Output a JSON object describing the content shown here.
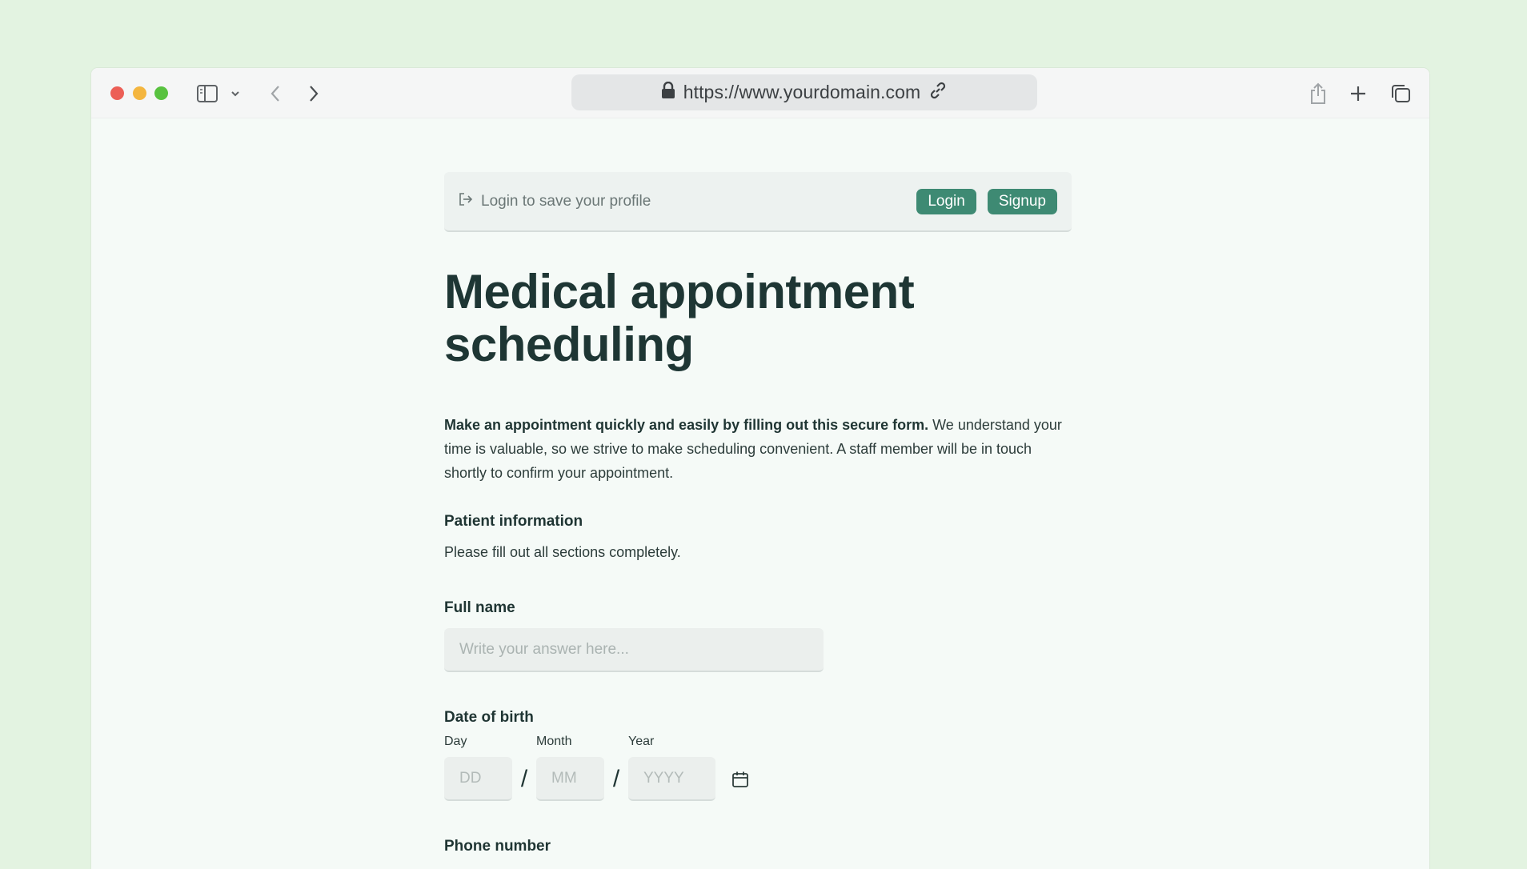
{
  "browser": {
    "url": "https://www.yourdomain.com",
    "icons": [
      "lock-icon",
      "link-icon",
      "sidebar-icon",
      "chevron-down-icon",
      "back-icon",
      "forward-icon",
      "share-icon",
      "new-tab-icon",
      "tabs-overview-icon"
    ]
  },
  "login_bar": {
    "text": "Login to save your profile",
    "login_label": "Login",
    "signup_label": "Signup"
  },
  "page": {
    "title": "Medical appointment scheduling",
    "intro_bold": "Make an appointment quickly and easily by filling out this secure form.",
    "intro_rest": " We understand your time is valuable, so we strive to make scheduling convenient. A staff member will be in touch shortly to confirm your appointment."
  },
  "section": {
    "title": "Patient information",
    "subtitle": "Please fill out all sections completely."
  },
  "fields": {
    "full_name": {
      "label": "Full name",
      "placeholder": "Write your answer here..."
    },
    "dob": {
      "label": "Date of birth",
      "day_caption": "Day",
      "day_placeholder": "DD",
      "month_caption": "Month",
      "month_placeholder": "MM",
      "year_caption": "Year",
      "year_placeholder": "YYYY",
      "separator": "/"
    },
    "phone": {
      "label": "Phone number"
    }
  },
  "colors": {
    "background": "#e3f3e1",
    "page": "#f5faf7",
    "accent": "#3e8a73",
    "heading": "#1e3634"
  }
}
